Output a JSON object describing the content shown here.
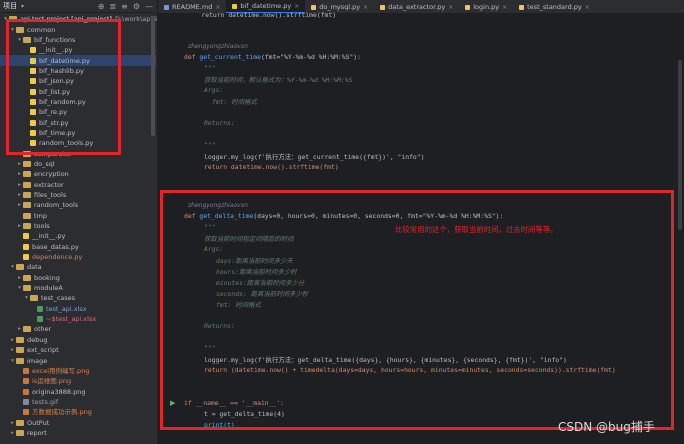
{
  "sidebar": {
    "title": "项目",
    "tools": [
      "⊕",
      "≣",
      "≡",
      "⚙",
      "—"
    ],
    "tree": [
      {
        "label": "api test project [api_project]",
        "suffix": "D:\\work\\apiTest",
        "depth": 0,
        "kind": "folder",
        "open": true,
        "color": "sel"
      },
      {
        "label": "common",
        "depth": 1,
        "kind": "folder",
        "open": true
      },
      {
        "label": "bif_functions",
        "depth": 2,
        "kind": "folder",
        "open": true
      },
      {
        "label": "__init__.py",
        "depth": 3,
        "kind": "py"
      },
      {
        "label": "bif_datetime.py",
        "depth": 3,
        "kind": "py",
        "selected": true
      },
      {
        "label": "bif_hashlib.py",
        "depth": 3,
        "kind": "py"
      },
      {
        "label": "bif_json.py",
        "depth": 3,
        "kind": "py"
      },
      {
        "label": "bif_list.py",
        "depth": 3,
        "kind": "py"
      },
      {
        "label": "bif_random.py",
        "depth": 3,
        "kind": "py"
      },
      {
        "label": "bif_re.py",
        "depth": 3,
        "kind": "py"
      },
      {
        "label": "bif_str.py",
        "depth": 3,
        "kind": "py"
      },
      {
        "label": "bif_time.py",
        "depth": 3,
        "kind": "py"
      },
      {
        "label": "random_tools.py",
        "depth": 3,
        "kind": "py"
      },
      {
        "label": "comparator",
        "depth": 2,
        "kind": "folder"
      },
      {
        "label": "do_sql",
        "depth": 2,
        "kind": "folder"
      },
      {
        "label": "encryption",
        "depth": 2,
        "kind": "folder"
      },
      {
        "label": "extractor",
        "depth": 2,
        "kind": "folder"
      },
      {
        "label": "files_tools",
        "depth": 2,
        "kind": "folder"
      },
      {
        "label": "random_tools",
        "depth": 2,
        "kind": "folder"
      },
      {
        "label": "tmp",
        "depth": 2,
        "kind": "folder",
        "noarrow": true
      },
      {
        "label": "tools",
        "depth": 2,
        "kind": "folder"
      },
      {
        "label": "__init__.py",
        "depth": 2,
        "kind": "py"
      },
      {
        "label": "base_datas.py",
        "depth": 2,
        "kind": "py"
      },
      {
        "label": "dependence.py",
        "depth": 2,
        "kind": "py",
        "color": "orange"
      },
      {
        "label": "data",
        "depth": 1,
        "kind": "folder",
        "open": true
      },
      {
        "label": "booking",
        "depth": 2,
        "kind": "folder"
      },
      {
        "label": "moduleA",
        "depth": 2,
        "kind": "folder",
        "open": true
      },
      {
        "label": "test_cases",
        "depth": 3,
        "kind": "folder",
        "open": true
      },
      {
        "label": "test_api.xlsx",
        "depth": 4,
        "kind": "xlsx",
        "color": "blue"
      },
      {
        "label": "~$test_api.xlsx",
        "depth": 4,
        "kind": "xlsx",
        "color": "red"
      },
      {
        "label": "other",
        "depth": 2,
        "kind": "folder"
      },
      {
        "label": "debug",
        "depth": 1,
        "kind": "folder"
      },
      {
        "label": "ext_script",
        "depth": 1,
        "kind": "folder"
      },
      {
        "label": "image",
        "depth": 1,
        "kind": "folder",
        "open": true
      },
      {
        "label": "excel用例编写.png",
        "depth": 2,
        "kind": "png",
        "color": "orange"
      },
      {
        "label": "is运维图.png",
        "depth": 2,
        "kind": "png",
        "color": "orange"
      },
      {
        "label": "origina3888.png",
        "depth": 2,
        "kind": "png"
      },
      {
        "label": "tests.gif",
        "depth": 2,
        "kind": "gif",
        "color": "muted"
      },
      {
        "label": "方数据成功示例.png",
        "depth": 2,
        "kind": "png",
        "color": "orange"
      },
      {
        "label": "OutPut",
        "depth": 1,
        "kind": "folder"
      },
      {
        "label": "report",
        "depth": 1,
        "kind": "folder"
      }
    ]
  },
  "tabs": [
    {
      "label": "README.md",
      "kind": "md"
    },
    {
      "label": "bif_datetime.py",
      "kind": "py",
      "active": true
    },
    {
      "label": "do_mysql.py",
      "kind": "py"
    },
    {
      "label": "data_extractor.py",
      "kind": "py"
    },
    {
      "label": "login.py",
      "kind": "py"
    },
    {
      "label": "test_standard.py",
      "kind": "py"
    }
  ],
  "code": {
    "line0": "    return datetime.now().strftime(fmt)",
    "author1": "zhengyongzhiaovxn",
    "def1_kw": "def ",
    "def1_name": "get_current_time",
    "def1_params": "(fmt=\"%Y-%m-%d %H:%M:%S\"):",
    "doc_open": "\"\"\"",
    "doc1_text": "获取当前时间，默认格式为：%Y-%m-%d %H:%M:%S",
    "args": "Args:",
    "fmt_line": "fmt: 时间格式",
    "returns": "Returns:",
    "doc_close": "\"\"\"",
    "log1_a": "logger.my_log(f'执行方法：get_current_time({fmt})', \"info\")",
    "ret1": "return datetime.now().strftime(fmt)",
    "author2": "zhengyongzhiaovxn",
    "def2_kw": "def ",
    "def2_name": "get_delta_time",
    "def2_params": "(days=0, hours=0, minutes=0, seconds=0, fmt=\"%Y-%m-%d %H:%M:%S\"):",
    "doc2_text": "获取当前时间指定间隔后的时间",
    "args2": "Args:",
    "arg_days": "days:距离当前时间多少天",
    "arg_hours": "hours:距离当前时间多少时",
    "arg_minutes": "minutes:距离当前时间多少分",
    "arg_seconds": "seconds: 距离当前时间多少秒",
    "arg_fmt": "fmt: 时间格式",
    "returns2": "Returns:",
    "log2": "logger.my_log(f'执行方法：get_delta_time({days}, {hours}, {minutes}, {seconds}, {fmt})', \"info\")",
    "ret2": "return (datetime.now() + timedelta(days=days, hours=hours, minutes=minutes, seconds=seconds)).strftime(fmt)",
    "main_if": "if __name__ == '__main__':",
    "main_t": "t = get_delta_time(4)",
    "main_print": "print(t)"
  },
  "annotation_note": "比较常用的这个，获取当前时间，过去时间等等。",
  "watermark": "CSDN @bug捕手"
}
